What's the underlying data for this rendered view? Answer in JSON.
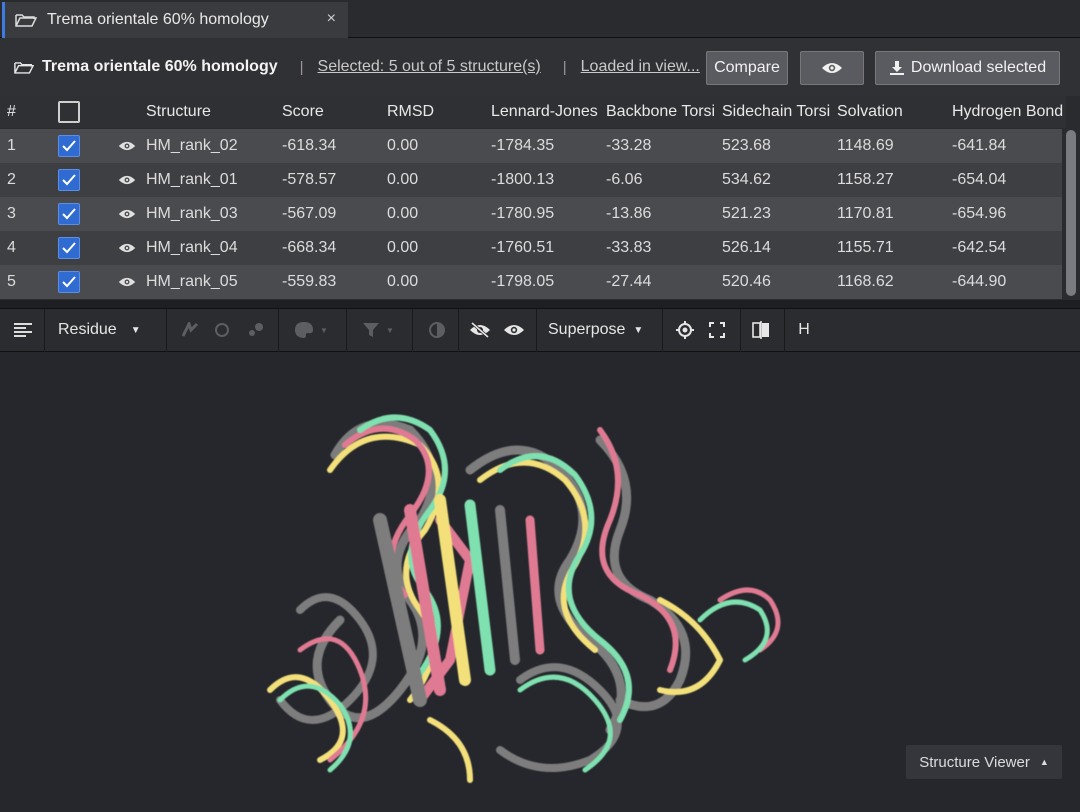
{
  "tab": {
    "title": "Trema orientale 60% homology",
    "close_glyph": "×"
  },
  "header": {
    "title": "Trema orientale 60% homology",
    "separator": "|",
    "selected_link": "Selected: 5 out of 5 structure(s)",
    "loaded_link": "Loaded in view...",
    "compare_label": "Compare",
    "download_label": "Download selected"
  },
  "table": {
    "headers": [
      "#",
      "",
      "Structure",
      "Score",
      "RMSD",
      "Lennard-Jones",
      "Backbone Torsi",
      "Sidechain Torsi",
      "Solvation",
      "Hydrogen Bond"
    ],
    "rows": [
      {
        "num": "1",
        "name": "HM_rank_02",
        "score": "-618.34",
        "rmsd": "0.00",
        "lj": "-1784.35",
        "bb": "-33.28",
        "sc": "523.68",
        "solv": "1148.69",
        "hb": "-641.84"
      },
      {
        "num": "2",
        "name": "HM_rank_01",
        "score": "-578.57",
        "rmsd": "0.00",
        "lj": "-1800.13",
        "bb": "-6.06",
        "sc": "534.62",
        "solv": "1158.27",
        "hb": "-654.04"
      },
      {
        "num": "3",
        "name": "HM_rank_03",
        "score": "-567.09",
        "rmsd": "0.00",
        "lj": "-1780.95",
        "bb": "-13.86",
        "sc": "521.23",
        "solv": "1170.81",
        "hb": "-654.96"
      },
      {
        "num": "4",
        "name": "HM_rank_04",
        "score": "-668.34",
        "rmsd": "0.00",
        "lj": "-1760.51",
        "bb": "-33.83",
        "sc": "526.14",
        "solv": "1155.71",
        "hb": "-642.54"
      },
      {
        "num": "5",
        "name": "HM_rank_05",
        "score": "-559.83",
        "rmsd": "0.00",
        "lj": "-1798.05",
        "bb": "-27.44",
        "sc": "520.46",
        "solv": "1168.62",
        "hb": "-644.90"
      }
    ]
  },
  "toolbar": {
    "residue_label": "Residue",
    "superpose_label": "Superpose",
    "h_label": "H"
  },
  "viewer": {
    "dropdown_label": "Structure Viewer"
  },
  "colors": {
    "accent": "#2f6bd1",
    "ribbon_green": "#7fe0b0",
    "ribbon_pink": "#e07a93",
    "ribbon_yellow": "#f3e07a",
    "ribbon_gray": "#8a8a8a"
  }
}
